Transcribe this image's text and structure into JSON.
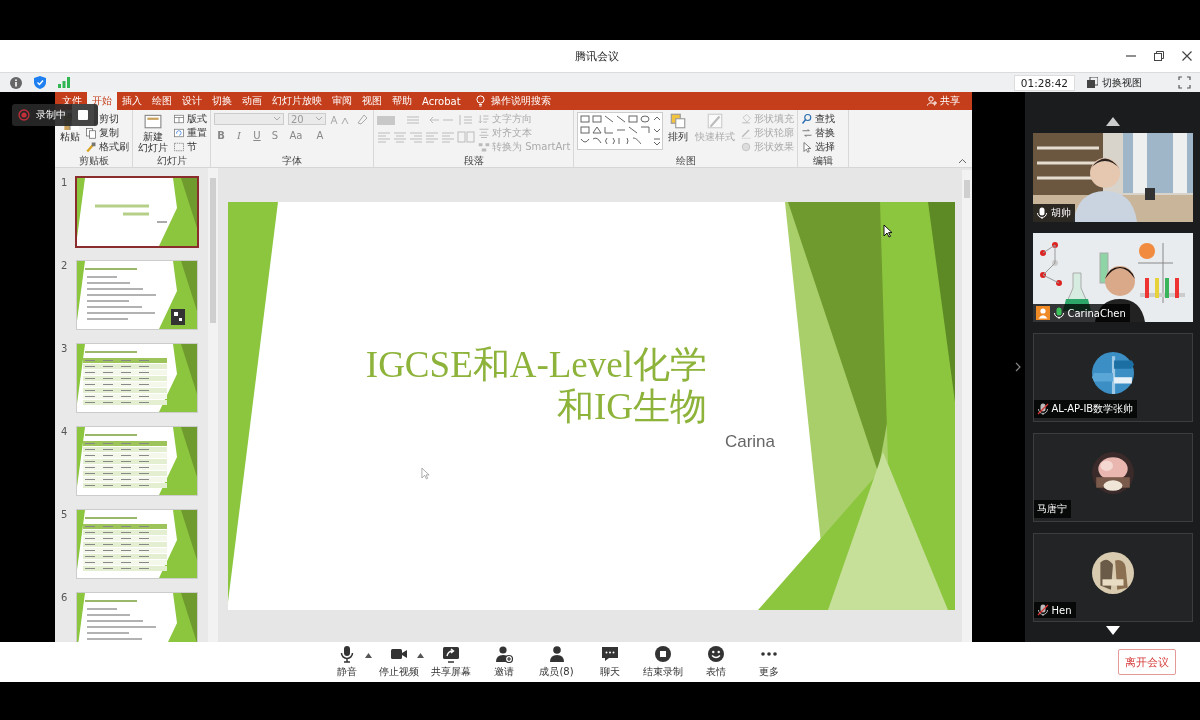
{
  "window": {
    "title": "腾讯会议"
  },
  "info_bar": {
    "timer": "01:28:42",
    "switch_view": "切换视图"
  },
  "recording": {
    "label": "录制中"
  },
  "presentation": {
    "ribbon_tabs": [
      {
        "label": "文件",
        "selected": false
      },
      {
        "label": "开始",
        "selected": true
      },
      {
        "label": "插入",
        "selected": false
      },
      {
        "label": "绘图",
        "selected": false
      },
      {
        "label": "设计",
        "selected": false
      },
      {
        "label": "切换",
        "selected": false
      },
      {
        "label": "动画",
        "selected": false
      },
      {
        "label": "幻灯片放映",
        "selected": false
      },
      {
        "label": "审阅",
        "selected": false
      },
      {
        "label": "视图",
        "selected": false
      },
      {
        "label": "帮助",
        "selected": false
      },
      {
        "label": "Acrobat",
        "selected": false
      }
    ],
    "tell_me": "操作说明搜索",
    "share": "共享",
    "ribbon_groups": [
      {
        "title": "剪贴板",
        "kind": "commands",
        "commands": [
          {
            "lines": [
              "粘贴"
            ],
            "kind": "large",
            "disabled": false
          },
          {
            "lines": [
              "剪切"
            ],
            "kind": "small",
            "disabled": false
          },
          {
            "lines": [
              "复制"
            ],
            "kind": "small",
            "disabled": false
          },
          {
            "lines": [
              "格式刷"
            ],
            "kind": "small",
            "disabled": false
          }
        ]
      },
      {
        "title": "幻灯片",
        "kind": "commands",
        "commands": [
          {
            "lines": [
              "新建",
              "幻灯片"
            ],
            "kind": "large",
            "disabled": false
          },
          {
            "lines": [
              "版式"
            ],
            "kind": "small",
            "disabled": false
          },
          {
            "lines": [
              "重置"
            ],
            "kind": "small",
            "disabled": false
          },
          {
            "lines": [
              "节"
            ],
            "kind": "small",
            "disabled": false
          }
        ]
      },
      {
        "title": "字体",
        "kind": "font",
        "size": "20",
        "buttons": [
          "B",
          "I",
          "U",
          "S",
          "Aa",
          "A"
        ],
        "disabled": true
      },
      {
        "title": "段落",
        "kind": "paragraph",
        "commands": [
          {
            "lines": [
              "文字方向"
            ],
            "kind": "small",
            "disabled": true
          },
          {
            "lines": [
              "对齐文本"
            ],
            "kind": "small",
            "disabled": true
          },
          {
            "lines": [
              "转换为 SmartArt"
            ],
            "kind": "small",
            "disabled": true
          }
        ]
      },
      {
        "title": "绘图",
        "kind": "drawing",
        "commands": [
          {
            "lines": [
              "排列"
            ],
            "kind": "large",
            "disabled": false
          },
          {
            "lines": [
              "快速样式"
            ],
            "kind": "large",
            "disabled": true
          },
          {
            "lines": [
              "形状填充"
            ],
            "kind": "small",
            "disabled": true
          },
          {
            "lines": [
              "形状轮廓"
            ],
            "kind": "small",
            "disabled": true
          },
          {
            "lines": [
              "形状效果"
            ],
            "kind": "small",
            "disabled": true
          }
        ]
      },
      {
        "title": "编辑",
        "kind": "commands",
        "commands": [
          {
            "lines": [
              "查找"
            ],
            "kind": "small",
            "disabled": false
          },
          {
            "lines": [
              "替换"
            ],
            "kind": "small",
            "disabled": false
          },
          {
            "lines": [
              "选择"
            ],
            "kind": "small",
            "disabled": false
          }
        ]
      }
    ],
    "thumbnails": [
      {
        "number": "1",
        "selected": true
      },
      {
        "number": "2",
        "selected": false
      },
      {
        "number": "3",
        "selected": false
      },
      {
        "number": "4",
        "selected": false
      },
      {
        "number": "5",
        "selected": false
      },
      {
        "number": "6",
        "selected": false
      }
    ],
    "slide": {
      "title_lines": [
        "IGCSE和A-Level化学",
        "和IG生物"
      ],
      "subtitle": "Carina"
    }
  },
  "participants": [
    {
      "name": "胡帅",
      "kind": "camera",
      "audio": true,
      "muted": false,
      "speaking": false,
      "host": false
    },
    {
      "name": "CarinaChen",
      "kind": "camera",
      "audio": true,
      "muted": false,
      "speaking": true,
      "host": true
    },
    {
      "name": "AL-AP-IB数学张帅",
      "kind": "avatar",
      "audio": true,
      "muted": true,
      "speaking": false,
      "host": false
    },
    {
      "name": "马唐宁",
      "kind": "avatar",
      "audio": false,
      "muted": false,
      "speaking": false,
      "host": false
    },
    {
      "name": "Hen",
      "kind": "avatar",
      "audio": true,
      "muted": true,
      "speaking": false,
      "host": false
    }
  ],
  "toolbar": [
    {
      "label": "静音",
      "menu": true
    },
    {
      "label": "停止视频",
      "menu": true
    },
    {
      "label": "共享屏幕",
      "menu": false
    },
    {
      "label": "邀请",
      "menu": false
    },
    {
      "label": "成员(8)",
      "menu": false
    },
    {
      "label": "聊天",
      "menu": false
    },
    {
      "label": "结束录制",
      "menu": false
    },
    {
      "label": "表情",
      "menu": false
    },
    {
      "label": "更多",
      "menu": false
    }
  ],
  "leave_button": "离开会议"
}
